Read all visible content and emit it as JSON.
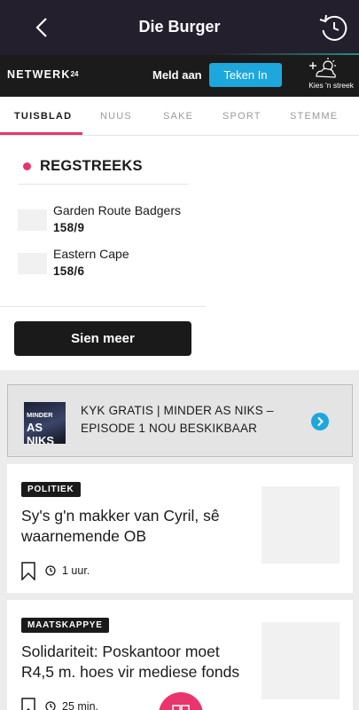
{
  "topbar": {
    "title": "Die Burger",
    "back_icon": "chevron-left-icon",
    "refresh_icon": "refresh-icon"
  },
  "subbar": {
    "logo_main": "NETWERK",
    "logo_sub": "24",
    "login_label": "Meld aan",
    "signup_label": "Teken In",
    "weather_label": "Kies 'n streek"
  },
  "tabs": [
    {
      "label": "TUISBLAD",
      "active": true
    },
    {
      "label": "NUUS",
      "active": false
    },
    {
      "label": "SAKE",
      "active": false
    },
    {
      "label": "SPORT",
      "active": false
    },
    {
      "label": "STEMME",
      "active": false
    }
  ],
  "live": {
    "title": "REGSTREEKS",
    "teams": [
      {
        "name": "Garden Route Badgers",
        "score": "158/9"
      },
      {
        "name": "Eastern Cape",
        "score": "158/6"
      }
    ],
    "see_more": "Sien meer"
  },
  "promo": {
    "thumb_line1": "MINDER",
    "thumb_line2": "AS NIKS",
    "text": "KYK GRATIS | MINDER AS NIKS – EPISODE 1 NOU BESKIKBAAR"
  },
  "articles": [
    {
      "tag": "POLITIEK",
      "headline": "Sy's g'n makker van Cyril, sê waarnemende OB",
      "time": "1 uur."
    },
    {
      "tag": "MAATSKAPPYE",
      "headline": "Solidariteit: Poskantoor moet R4,5 m. hoes vir mediese fonds",
      "time": "25 min."
    }
  ],
  "colors": {
    "accent": "#e8356c",
    "button_blue": "#1ea7dd",
    "topbar": "#231f2c"
  }
}
